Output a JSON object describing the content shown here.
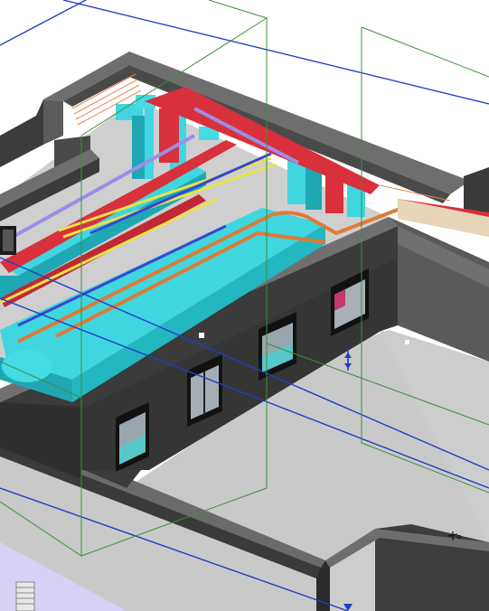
{
  "viewport": {
    "view_type": "3D",
    "background": "#ffffff"
  },
  "colors": {
    "wall_top": "#6e6e6e",
    "wall_side": "#3a3a3a",
    "wall_dark": "#2c2c2c",
    "roof_slab": "#cfcfcf",
    "floor": "#c9c9c9",
    "duct_cyan": "#3fd6e0",
    "duct_cyan_dark": "#1fa7b3",
    "pipe_red": "#d8313b",
    "pipe_orange": "#e07a35",
    "pipe_yellow": "#e9e34a",
    "pipe_blue": "#3a46d0",
    "pipe_violet": "#9c8ee6",
    "grid_blue": "#1f3fc4",
    "scope_green": "#3c8f3c",
    "lavender_zone": "#d6d2f5"
  },
  "annotations": {
    "level_marker_symbol": "elevation-marker-icon",
    "section_marker_symbol": "section-marker-icon"
  }
}
